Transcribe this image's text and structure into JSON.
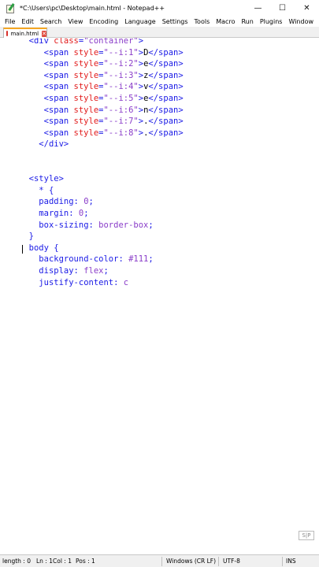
{
  "window": {
    "title": "*C:\\Users\\pc\\Desktop\\main.html - Notepad++",
    "controls": {
      "minimize": "—",
      "maximize": "☐",
      "close": "✕"
    }
  },
  "menu": [
    "File",
    "Edit",
    "Search",
    "View",
    "Encoding",
    "Language",
    "Settings",
    "Tools",
    "Macro",
    "Run",
    "Plugins",
    "Window"
  ],
  "tab": {
    "label": "main.html",
    "close": "✕"
  },
  "code": [
    {
      "indent": "  ",
      "tokens": [
        [
          "tag",
          "<div"
        ],
        [
          "attr",
          " class"
        ],
        [
          "tag",
          "="
        ],
        [
          "str",
          "\"container\""
        ],
        [
          "tag",
          ">"
        ]
      ]
    },
    {
      "indent": "     ",
      "tokens": [
        [
          "tag",
          "<span"
        ],
        [
          "attr",
          " style"
        ],
        [
          "tag",
          "="
        ],
        [
          "str",
          "\"--i:1\""
        ],
        [
          "tag",
          ">"
        ],
        [
          "text",
          "D"
        ],
        [
          "tag",
          "</span>"
        ]
      ]
    },
    {
      "indent": "     ",
      "tokens": [
        [
          "tag",
          "<span"
        ],
        [
          "attr",
          " style"
        ],
        [
          "tag",
          "="
        ],
        [
          "str",
          "\"--i:2\""
        ],
        [
          "tag",
          ">"
        ],
        [
          "text",
          "e"
        ],
        [
          "tag",
          "</span>"
        ]
      ]
    },
    {
      "indent": "     ",
      "tokens": [
        [
          "tag",
          "<span"
        ],
        [
          "attr",
          " style"
        ],
        [
          "tag",
          "="
        ],
        [
          "str",
          "\"--i:3\""
        ],
        [
          "tag",
          ">"
        ],
        [
          "text",
          "z"
        ],
        [
          "tag",
          "</span>"
        ]
      ]
    },
    {
      "indent": "     ",
      "tokens": [
        [
          "tag",
          "<span"
        ],
        [
          "attr",
          " style"
        ],
        [
          "tag",
          "="
        ],
        [
          "str",
          "\"--i:4\""
        ],
        [
          "tag",
          ">"
        ],
        [
          "text",
          "v"
        ],
        [
          "tag",
          "</span>"
        ]
      ]
    },
    {
      "indent": "     ",
      "tokens": [
        [
          "tag",
          "<span"
        ],
        [
          "attr",
          " style"
        ],
        [
          "tag",
          "="
        ],
        [
          "str",
          "\"--i:5\""
        ],
        [
          "tag",
          ">"
        ],
        [
          "text",
          "e"
        ],
        [
          "tag",
          "</span>"
        ]
      ]
    },
    {
      "indent": "     ",
      "tokens": [
        [
          "tag",
          "<span"
        ],
        [
          "attr",
          " style"
        ],
        [
          "tag",
          "="
        ],
        [
          "str",
          "\"--i:6\""
        ],
        [
          "tag",
          ">"
        ],
        [
          "text",
          "n"
        ],
        [
          "tag",
          "</span>"
        ]
      ]
    },
    {
      "indent": "     ",
      "tokens": [
        [
          "tag",
          "<span"
        ],
        [
          "attr",
          " style"
        ],
        [
          "tag",
          "="
        ],
        [
          "str",
          "\"--i:7\""
        ],
        [
          "tag",
          ">"
        ],
        [
          "text",
          "."
        ],
        [
          "tag",
          "</span>"
        ]
      ]
    },
    {
      "indent": "     ",
      "tokens": [
        [
          "tag",
          "<span"
        ],
        [
          "attr",
          " style"
        ],
        [
          "tag",
          "="
        ],
        [
          "str",
          "\"--i:8\""
        ],
        [
          "tag",
          ">"
        ],
        [
          "text",
          "."
        ],
        [
          "tag",
          "</span>"
        ]
      ]
    },
    {
      "indent": "    ",
      "tokens": [
        [
          "tag",
          "</div>"
        ]
      ]
    },
    {
      "indent": "",
      "tokens": []
    },
    {
      "indent": "",
      "tokens": []
    },
    {
      "indent": "  ",
      "tokens": [
        [
          "tag",
          "<style>"
        ]
      ]
    },
    {
      "indent": "    ",
      "tokens": [
        [
          "sel",
          "* {"
        ]
      ]
    },
    {
      "indent": "    ",
      "tokens": [
        [
          "prop",
          "padding: "
        ],
        [
          "val",
          "0"
        ],
        [
          "prop",
          ";"
        ]
      ]
    },
    {
      "indent": "    ",
      "tokens": [
        [
          "prop",
          "margin: "
        ],
        [
          "val",
          "0"
        ],
        [
          "prop",
          ";"
        ]
      ]
    },
    {
      "indent": "    ",
      "tokens": [
        [
          "prop",
          "box-sizing: "
        ],
        [
          "val",
          "border-box"
        ],
        [
          "prop",
          ";"
        ]
      ]
    },
    {
      "indent": "  ",
      "tokens": [
        [
          "sel",
          "}"
        ]
      ]
    },
    {
      "indent": "  ",
      "tokens": [
        [
          "sel",
          "body {"
        ]
      ]
    },
    {
      "indent": "    ",
      "tokens": [
        [
          "prop",
          "background-color: "
        ],
        [
          "val",
          "#111"
        ],
        [
          "prop",
          ";"
        ]
      ]
    },
    {
      "indent": "    ",
      "tokens": [
        [
          "prop",
          "display: "
        ],
        [
          "val",
          "flex"
        ],
        [
          "prop",
          ";"
        ]
      ]
    },
    {
      "indent": "    ",
      "tokens": [
        [
          "prop",
          "justify-content: "
        ],
        [
          "val",
          "c"
        ]
      ]
    }
  ],
  "status": {
    "length": "length : 0",
    "ln": "Ln : 1",
    "col": "Col : 1",
    "pos": "Pos : 1",
    "eol": "Windows (CR LF)",
    "encoding": "UTF-8",
    "mode": "INS"
  },
  "corner_mark": "S|P",
  "colors": {
    "tag": "#1a1ae6",
    "attr": "#e21b1b",
    "string": "#8a3dc9",
    "tab_accent": "#f5a623"
  }
}
